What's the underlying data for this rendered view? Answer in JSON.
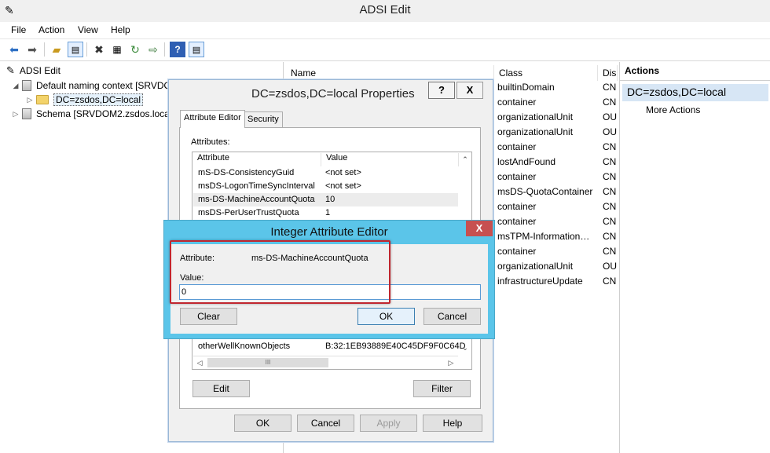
{
  "app": {
    "title": "ADSI Edit"
  },
  "menu": [
    "File",
    "Action",
    "View",
    "Help"
  ],
  "toolbar": {
    "icons": [
      "back-icon",
      "forward-icon",
      "up-folder-icon",
      "show-hide-tree-icon",
      "delete-icon",
      "properties-icon",
      "refresh-icon",
      "export-icon",
      "help-icon",
      "show-hide-action-icon"
    ]
  },
  "tree": {
    "root": "ADSI Edit",
    "items": [
      {
        "label": "Default naming context [SRVDO"
      },
      {
        "label": "DC=zsdos,DC=local"
      },
      {
        "label": "Schema [SRVDOM2.zsdos.local"
      }
    ]
  },
  "list": {
    "columns": {
      "name": "Name",
      "class": "Class",
      "dis": "Dis"
    },
    "classes": [
      "builtinDomain",
      "container",
      "organizationalUnit",
      "organizationalUnit",
      "container",
      "lostAndFound",
      "container",
      "msDS-QuotaContainer",
      "container",
      "container",
      "msTPM-Information…",
      "container",
      "organizationalUnit",
      "infrastructureUpdate"
    ],
    "dis": [
      "CN",
      "CN",
      "OU",
      "OU",
      "CN",
      "CN",
      "CN",
      "CN",
      "CN",
      "CN",
      "CN",
      "CN",
      "OU",
      "CN"
    ]
  },
  "actions": {
    "header": "Actions",
    "selected": "DC=zsdos,DC=local",
    "more": "More Actions"
  },
  "properties": {
    "title": "DC=zsdos,DC=local Properties",
    "help_btn": "?",
    "close_btn": "X",
    "tabs": [
      "Attribute Editor",
      "Security"
    ],
    "attributes_label": "Attributes:",
    "col_attribute": "Attribute",
    "col_value": "Value",
    "rows": [
      {
        "attr": "mS-DS-ConsistencyGuid",
        "value": "<not set>"
      },
      {
        "attr": "msDS-LogonTimeSyncInterval",
        "value": "<not set>"
      },
      {
        "attr": "ms-DS-MachineAccountQuota",
        "value": "10"
      },
      {
        "attr": "msDS-PerUserTrustQuota",
        "value": "1"
      }
    ],
    "last_row": {
      "attr": "otherWellKnownObjects",
      "value": "B:32:1EB93889E40C45DF9F0C64D"
    },
    "scroll_thumb": "III",
    "edit": "Edit",
    "filter": "Filter",
    "ok": "OK",
    "cancel": "Cancel",
    "apply": "Apply",
    "help": "Help"
  },
  "editor": {
    "title": "Integer Attribute Editor",
    "close": "X",
    "attribute_label": "Attribute:",
    "attribute_value": "ms-DS-MachineAccountQuota",
    "value_label": "Value:",
    "value": "0",
    "clear": "Clear",
    "ok": "OK",
    "cancel": "Cancel"
  }
}
